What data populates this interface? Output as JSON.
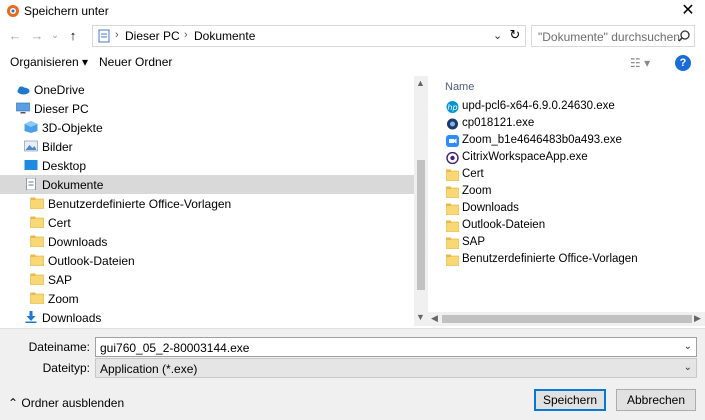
{
  "window": {
    "title": "Speichern unter",
    "close_glyph": "✕",
    "icon": "app-icon"
  },
  "nav": {
    "back": "←",
    "forward": "→",
    "recent": "⌄",
    "up": "↑",
    "breadcrumb": [
      "Dieser PC",
      "Dokumente"
    ],
    "refresh": "↻",
    "search_placeholder": "\"Dokumente\" durchsuchen"
  },
  "toolbar": {
    "organize": "Organisieren ▾",
    "new_folder": "Neuer Ordner",
    "view": "☷ ▾",
    "help": "?"
  },
  "tree": [
    {
      "label": "OneDrive",
      "icon": "onedrive-icon",
      "indent": 0
    },
    {
      "label": "Dieser PC",
      "icon": "pc-icon",
      "indent": 0
    },
    {
      "label": "3D-Objekte",
      "icon": "3d-objects-icon",
      "indent": 1
    },
    {
      "label": "Bilder",
      "icon": "pictures-icon",
      "indent": 1
    },
    {
      "label": "Desktop",
      "icon": "desktop-icon",
      "indent": 1
    },
    {
      "label": "Dokumente",
      "icon": "documents-icon",
      "indent": 1,
      "selected": true
    },
    {
      "label": "Benutzerdefinierte Office-Vorlagen",
      "icon": "folder-icon",
      "indent": 2
    },
    {
      "label": "Cert",
      "icon": "folder-icon",
      "indent": 2
    },
    {
      "label": "Downloads",
      "icon": "folder-icon",
      "indent": 2
    },
    {
      "label": "Outlook-Dateien",
      "icon": "folder-icon",
      "indent": 2
    },
    {
      "label": "SAP",
      "icon": "folder-icon",
      "indent": 2
    },
    {
      "label": "Zoom",
      "icon": "folder-icon",
      "indent": 2
    },
    {
      "label": "Downloads",
      "icon": "downloads-icon",
      "indent": 1
    }
  ],
  "files": {
    "column_header": "Name",
    "items": [
      {
        "label": "upd-pcl6-x64-6.9.0.24630.exe",
        "icon": "hp-icon"
      },
      {
        "label": "cp018121.exe",
        "icon": "installer-icon"
      },
      {
        "label": "Zoom_b1e4646483b0a493.exe",
        "icon": "zoom-icon"
      },
      {
        "label": "CitrixWorkspaceApp.exe",
        "icon": "citrix-icon"
      },
      {
        "label": "Cert",
        "icon": "folder-icon"
      },
      {
        "label": "Zoom",
        "icon": "folder-icon"
      },
      {
        "label": "Downloads",
        "icon": "folder-icon"
      },
      {
        "label": "Outlook-Dateien",
        "icon": "folder-icon"
      },
      {
        "label": "SAP",
        "icon": "folder-icon"
      },
      {
        "label": "Benutzerdefinierte Office-Vorlagen",
        "icon": "folder-icon"
      }
    ]
  },
  "form": {
    "filename_label": "Dateiname:",
    "filename_value": "gui760_05_2-80003144.exe",
    "filetype_label": "Dateityp:",
    "filetype_value": "Application (*.exe)",
    "save": "Speichern",
    "cancel": "Abbrechen",
    "toggle": "⌃  Ordner ausblenden"
  },
  "colors": {
    "selection": "#cce8ff",
    "link": "#003399",
    "accent": "#0078d7",
    "folder": "#f8d775"
  }
}
